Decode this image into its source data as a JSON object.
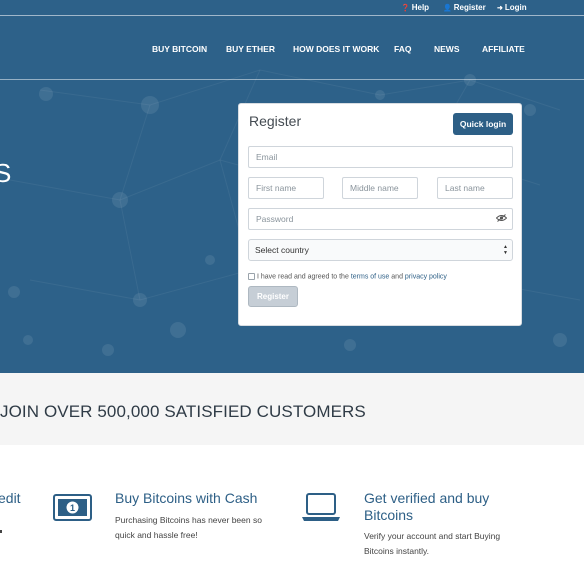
{
  "topbar": {
    "help": "Help",
    "register": "Register",
    "login": "Login"
  },
  "nav": {
    "items": [
      "BUY BITCOIN",
      "BUY ETHER",
      "HOW DOES IT WORK",
      "FAQ",
      "NEWS",
      "AFFILIATE"
    ]
  },
  "hero": {
    "partial_glyph": "S"
  },
  "register_form": {
    "title": "Register",
    "quick_login": "Quick login",
    "email_placeholder": "Email",
    "first_name_placeholder": "First name",
    "middle_name_placeholder": "Middle name",
    "last_name_placeholder": "Last name",
    "password_placeholder": "Password",
    "country_select": "Select country",
    "terms_prefix": "I have read and agreed to the",
    "terms_link": "terms of use",
    "terms_and": "and",
    "privacy_link": "privacy policy",
    "submit": "Register"
  },
  "join": {
    "text": "JOIN OVER 500,000 SATISFIED CUSTOMERS"
  },
  "features": {
    "left_partial": "edit",
    "cash": {
      "title": "Buy Bitcoins with Cash",
      "desc": "Purchasing Bitcoins has never been so quick and hassle free!"
    },
    "verified": {
      "title_line1": "Get verified and buy",
      "title_line2": "Bitcoins",
      "desc": "Verify your account and start Buying Bitcoins instantly."
    }
  },
  "colors": {
    "hero_bg": "#2d6189",
    "accent": "#2d5f86",
    "band_bg": "#f5f5f5"
  }
}
